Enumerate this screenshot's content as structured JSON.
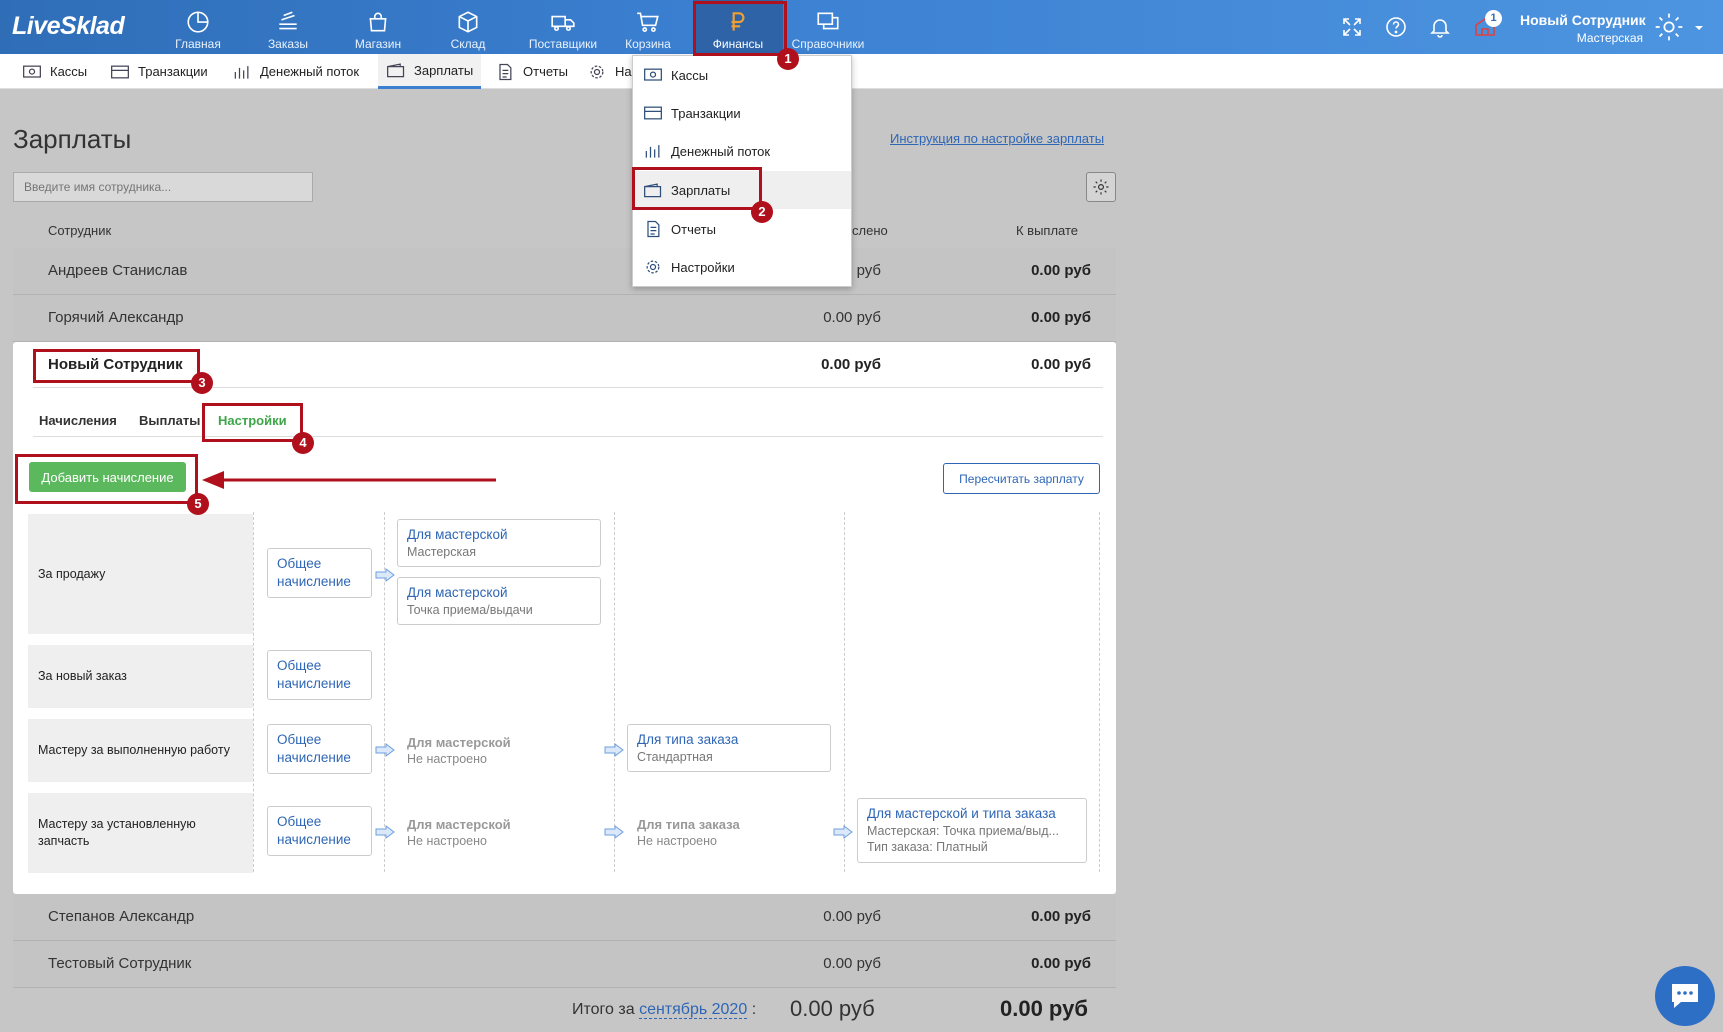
{
  "app": {
    "logo": "LiveSklad"
  },
  "topnav": {
    "items": [
      {
        "label": "Главная",
        "icon": "pie-chart-icon"
      },
      {
        "label": "Заказы",
        "icon": "stack-icon"
      },
      {
        "label": "Магазин",
        "icon": "shopping-bag-icon"
      },
      {
        "label": "Склад",
        "icon": "box-icon"
      },
      {
        "label": "Поставщики",
        "icon": "truck-icon"
      },
      {
        "label": "Корзина",
        "icon": "cart-icon"
      },
      {
        "label": "Финансы",
        "icon": "ruble-icon"
      },
      {
        "label": "Справочники",
        "icon": "windows-icon"
      }
    ],
    "active": "Финансы",
    "notification_count": "1",
    "user_name": "Новый Сотрудник",
    "user_role": "Мастерская"
  },
  "subnav": {
    "items": [
      "Кассы",
      "Транзакции",
      "Денежный поток",
      "Зарплаты",
      "Отчеты",
      "На"
    ],
    "active": "Зарплаты"
  },
  "dropdown": {
    "items": [
      "Кассы",
      "Транзакции",
      "Денежный поток",
      "Зарплаты",
      "Отчеты",
      "Настройки"
    ],
    "highlighted": "Зарплаты"
  },
  "page": {
    "title": "Зарплаты",
    "help_link": "Инструкция по настройке зарплаты",
    "search_placeholder": "Введите имя сотрудника...",
    "columns": {
      "employee": "Сотрудник",
      "accrued": "Начислено",
      "accrued_visible": "слено",
      "to_pay": "К выплате"
    }
  },
  "employees": [
    {
      "name": "Андреев Станислав",
      "accrued": "руб",
      "to_pay": "0.00 руб"
    },
    {
      "name": "Горячий Александр",
      "accrued": "0.00 руб",
      "to_pay": "0.00 руб"
    },
    {
      "name": "Новый Сотрудник",
      "accrued": "0.00 руб",
      "to_pay": "0.00 руб"
    },
    {
      "name": "Степанов Александр",
      "accrued": "0.00 руб",
      "to_pay": "0.00 руб"
    },
    {
      "name": "Тестовый Сотрудник",
      "accrued": "0.00 руб",
      "to_pay": "0.00 руб"
    }
  ],
  "card": {
    "tabs": [
      "Начисления",
      "Выплаты",
      "Настройки"
    ],
    "active_tab": "Настройки",
    "add_button": "Добавить начисление",
    "recalc_button": "Пересчитать зарплату",
    "rows": [
      {
        "label": "За продажу"
      },
      {
        "label": "За новый заказ"
      },
      {
        "label": "Мастеру за выполненную работу"
      },
      {
        "label": "Мастеру за установленную запчасть"
      }
    ],
    "general": "Общее начисление",
    "for_workshop": "Для мастерской",
    "workshop": "Мастерская",
    "pickup_point": "Точка приема/выдачи",
    "not_configured": "Не настроено",
    "for_order_type": "Для типа заказа",
    "standard": "Стандартная",
    "for_workshop_and_type": "Для мастерской и типа заказа",
    "workshop_pickup": "Мастерская: Точка приема/выд...",
    "order_type_paid": "Тип заказа: Платный"
  },
  "footer": {
    "total_prefix": "Итого за",
    "month": "сентябрь 2020",
    "colon": ":",
    "total_accrued": "0.00 руб",
    "total_to_pay": "0.00 руб"
  },
  "annotations": [
    "1",
    "2",
    "3",
    "4",
    "5"
  ],
  "colors": {
    "brand": "#3b7fd1",
    "accent_green": "#5cb85c",
    "annotation_red": "#b0101c",
    "link": "#2e66b5"
  }
}
